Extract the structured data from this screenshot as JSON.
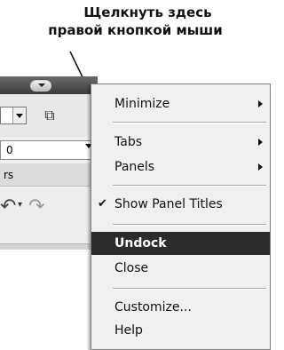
{
  "callout": {
    "line1": "Щелкнуть здесь",
    "line2": "правой кнопкой мыши"
  },
  "background_panel": {
    "number_value": "0",
    "tab_text": "rs"
  },
  "context_menu": {
    "items": [
      {
        "label": "Minimize",
        "submenu": true
      },
      {
        "label": "Tabs",
        "submenu": true
      },
      {
        "label": "Panels",
        "submenu": true
      },
      {
        "label": "Show Panel Titles",
        "checked": true
      },
      {
        "label": "Undock",
        "highlighted": true
      },
      {
        "label": "Close"
      },
      {
        "label": "Customize..."
      },
      {
        "label": "Help"
      }
    ],
    "highlight_color": "#2b2b2b"
  }
}
